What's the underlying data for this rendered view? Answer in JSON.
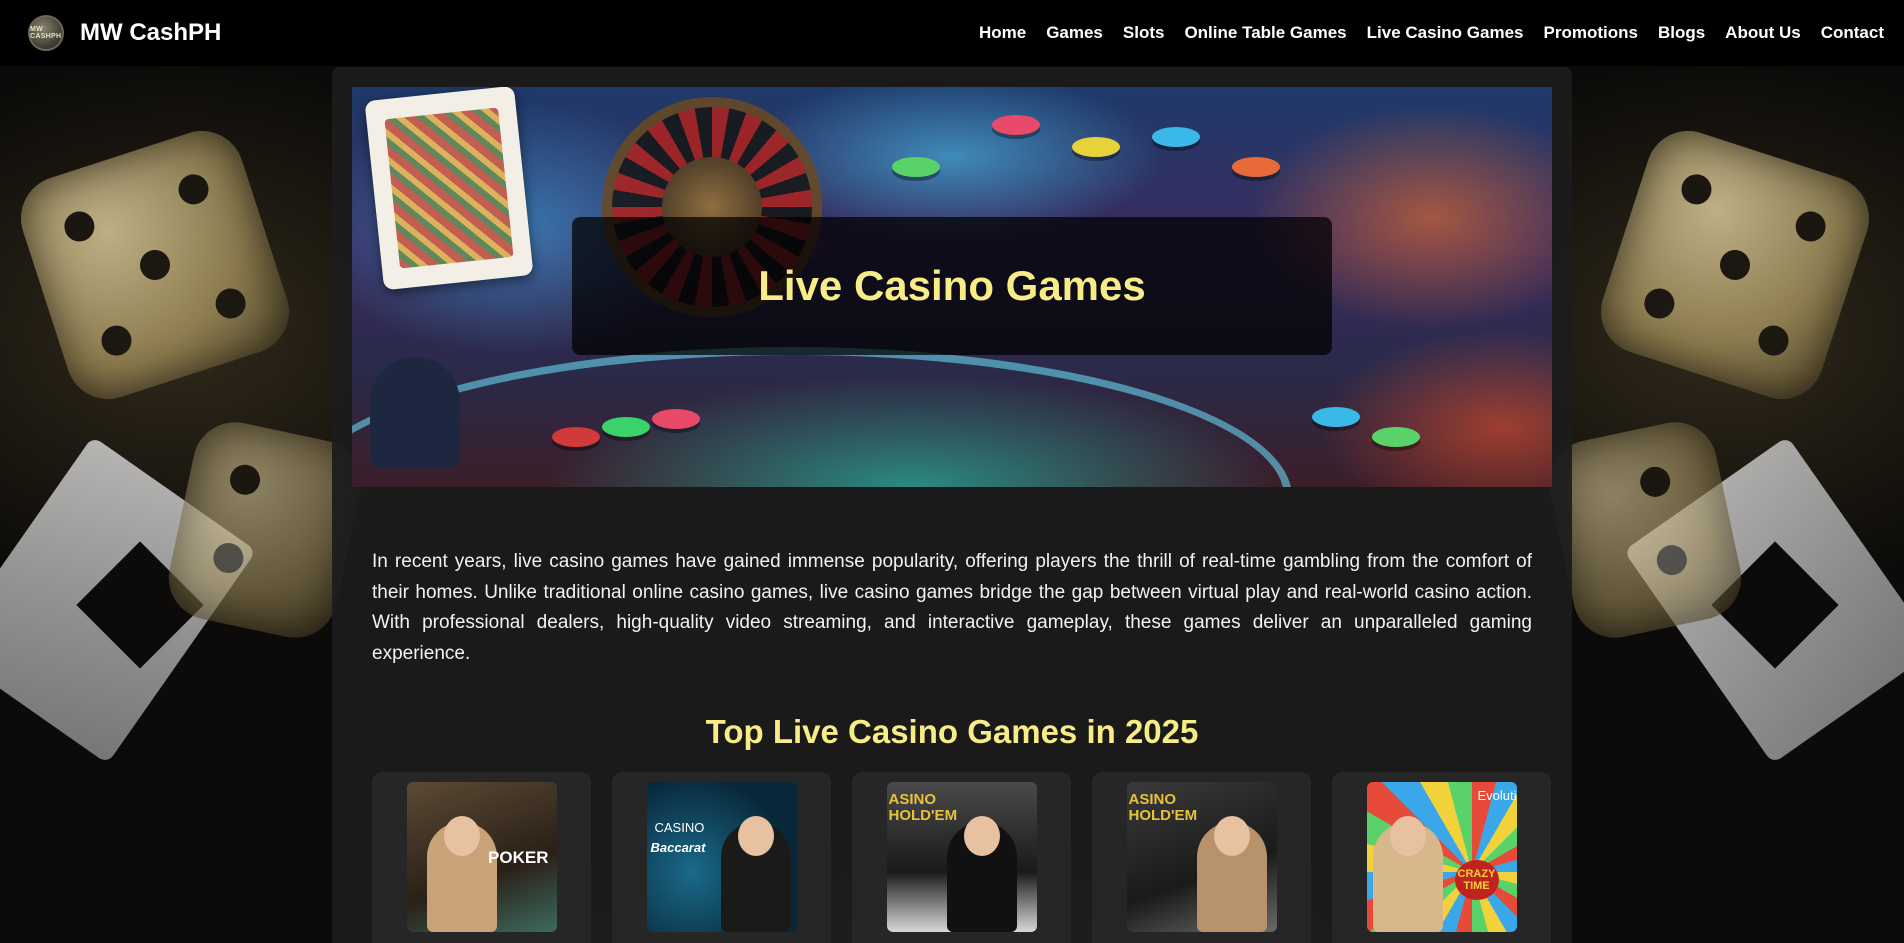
{
  "brand": {
    "logo_text": "MW CASHPH",
    "name": "MW CashPH"
  },
  "nav": {
    "items": [
      {
        "label": "Home"
      },
      {
        "label": "Games"
      },
      {
        "label": "Slots"
      },
      {
        "label": "Online Table Games"
      },
      {
        "label": "Live Casino Games"
      },
      {
        "label": "Promotions"
      },
      {
        "label": "Blogs"
      },
      {
        "label": "About Us"
      },
      {
        "label": "Contact"
      }
    ]
  },
  "hero": {
    "title": "Live Casino Games"
  },
  "intro": {
    "text": "In recent years, live casino games have gained immense popularity, offering players the thrill of real-time gambling from the comfort of their homes. Unlike traditional online casino games, live casino games bridge the gap between virtual play and real-world casino action. With professional dealers, high-quality video streaming, and interactive gameplay, these games deliver an unparalleled gaming experience."
  },
  "top_games": {
    "title": "Top Live Casino Games in 2025",
    "cards": [
      {
        "thumb_text": "POKER"
      },
      {
        "thumb_text": "Baccarat",
        "thumb_brand": "CASINO"
      },
      {
        "thumb_text": "ASINO HOLD'EM"
      },
      {
        "thumb_text": "ASINO HOLD'EM"
      },
      {
        "thumb_text": "CRAZY TIME",
        "thumb_brand": "Evoluti"
      }
    ]
  },
  "colors": {
    "accent_yellow": "#f7ec86",
    "navbar": "#000000",
    "container": "#1c1c1c"
  }
}
